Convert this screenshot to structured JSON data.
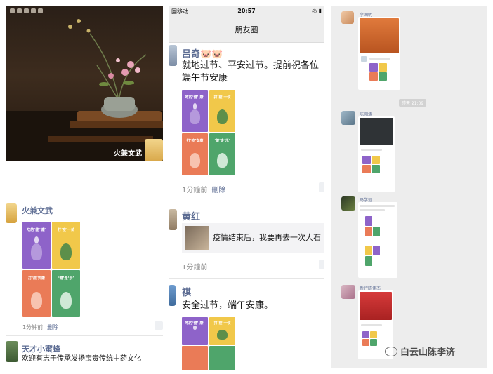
{
  "panel_left": {
    "cover_name": "火兼文武",
    "post1": {
      "nick": "火兼文武",
      "time": "1分钟前",
      "delete": "删除"
    },
    "post2": {
      "nick": "天才小蜜蜂",
      "text": "欢迎有志于传承发扬宝贵传统中药文化"
    }
  },
  "panel_middle": {
    "status": {
      "carrier": "国移动",
      "time": "20:57"
    },
    "title": "朋友圈",
    "post1": {
      "nick": "吕奇🐷🐷",
      "text_line1": "就地过节、平安过节。提前祝各位",
      "text_line2": "端午节安康",
      "time": "1分鐘前",
      "delete": "刪除"
    },
    "post2": {
      "nick": "黄红",
      "link_text": "疫情结束后，我要再去一次大石",
      "time": "1分鐘前"
    },
    "post3": {
      "nick": "祺",
      "text": "安全过节，端午安康。"
    }
  },
  "panel_right": {
    "names": [
      "李国明",
      "陈刚涛",
      "马学冠",
      "新行陈伟杰"
    ],
    "time_pill": "昨天 21:09"
  },
  "watermark": {
    "text": "白云山陈李济"
  },
  "poster_texts": [
    "吃的‘健’‘康’",
    "打‘疫’一仗",
    "打‘疫’安康",
    "‘健’走‘乐’"
  ],
  "colors": {
    "purple": "#8e63c9",
    "yellow": "#f1c84a",
    "orange": "#ea7b57",
    "green": "#4fa56b",
    "nick": "#5b6b92"
  }
}
